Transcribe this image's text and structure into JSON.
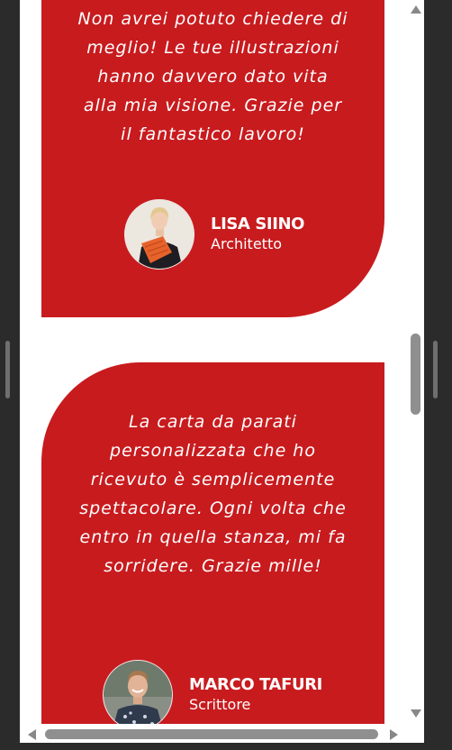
{
  "colors": {
    "card_red": "#c81b1e",
    "text": "#ffffff",
    "page_bg": "#ffffff",
    "frame_bg": "#2b2b2b",
    "scroll_thumb": "#8f8f8f"
  },
  "testimonials": [
    {
      "quote": "Non avrei potuto chiedere di meglio! Le tue illustrazioni hanno davvero dato vita alla mia visione. Grazie per il fantastico lavoro!",
      "name": "LISA SIINO",
      "role": "Architetto"
    },
    {
      "quote": "La carta da parati personalizzata che ho ricevuto è semplicemente spettacolare. Ogni volta che entro in quella stanza, mi fa sorridere. Grazie mille!",
      "name": "MARCO TAFURI",
      "role": "Scrittore"
    }
  ],
  "icons": {
    "scroll_up": "triangle-up",
    "scroll_down": "triangle-down",
    "scroll_left": "triangle-left",
    "scroll_right": "triangle-right"
  }
}
